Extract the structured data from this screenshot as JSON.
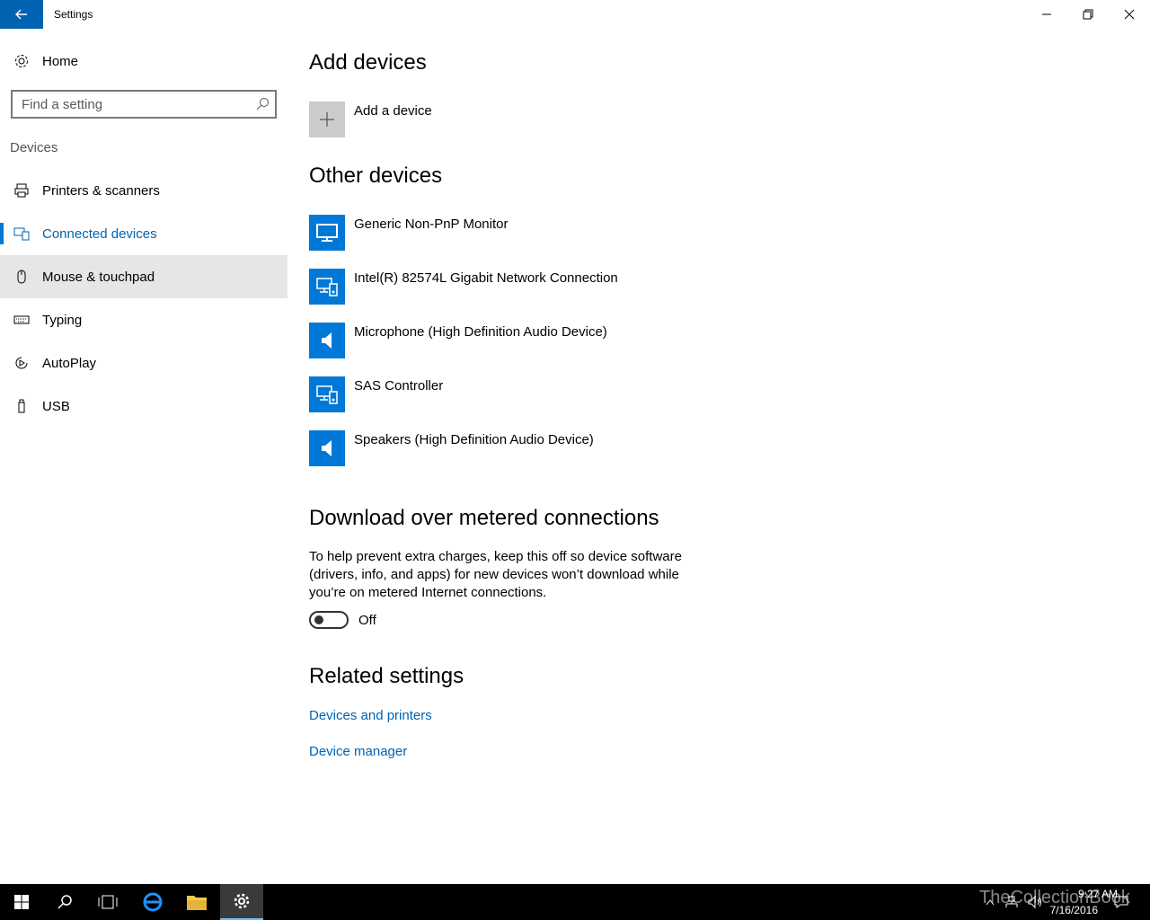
{
  "window": {
    "title": "Settings"
  },
  "sidebar": {
    "home_label": "Home",
    "search_placeholder": "Find a setting",
    "section_label": "Devices",
    "items": [
      {
        "label": "Printers & scanners",
        "icon": "printer-icon"
      },
      {
        "label": "Connected devices",
        "icon": "connected-devices-icon",
        "active": true
      },
      {
        "label": "Mouse & touchpad",
        "icon": "mouse-icon",
        "hovered": true
      },
      {
        "label": "Typing",
        "icon": "keyboard-icon"
      },
      {
        "label": "AutoPlay",
        "icon": "autoplay-icon"
      },
      {
        "label": "USB",
        "icon": "usb-icon"
      }
    ]
  },
  "main": {
    "add_devices_heading": "Add devices",
    "add_device_label": "Add a device",
    "other_devices_heading": "Other devices",
    "devices": [
      {
        "label": "Generic Non-PnP Monitor",
        "icon": "monitor-icon"
      },
      {
        "label": "Intel(R) 82574L Gigabit Network Connection",
        "icon": "network-device-icon"
      },
      {
        "label": "Microphone (High Definition Audio Device)",
        "icon": "speaker-icon"
      },
      {
        "label": "SAS Controller",
        "icon": "network-device-icon"
      },
      {
        "label": "Speakers (High Definition Audio Device)",
        "icon": "speaker-icon"
      }
    ],
    "metered_heading": "Download over metered connections",
    "metered_description": "To help prevent extra charges, keep this off so device software (drivers, info, and apps) for new devices won’t download while you’re on metered Internet connections.",
    "metered_toggle_state": "Off",
    "related_heading": "Related settings",
    "related_links": [
      "Devices and printers",
      "Device manager"
    ]
  },
  "taskbar": {
    "time": "9:27 AM",
    "date": "7/16/2016",
    "watermark": "TheCollectionBook"
  },
  "colors": {
    "accent": "#0078d7",
    "accent_dark": "#0063b1",
    "tile_gray": "#cccccc",
    "hover_bg": "#e6e6e6"
  }
}
